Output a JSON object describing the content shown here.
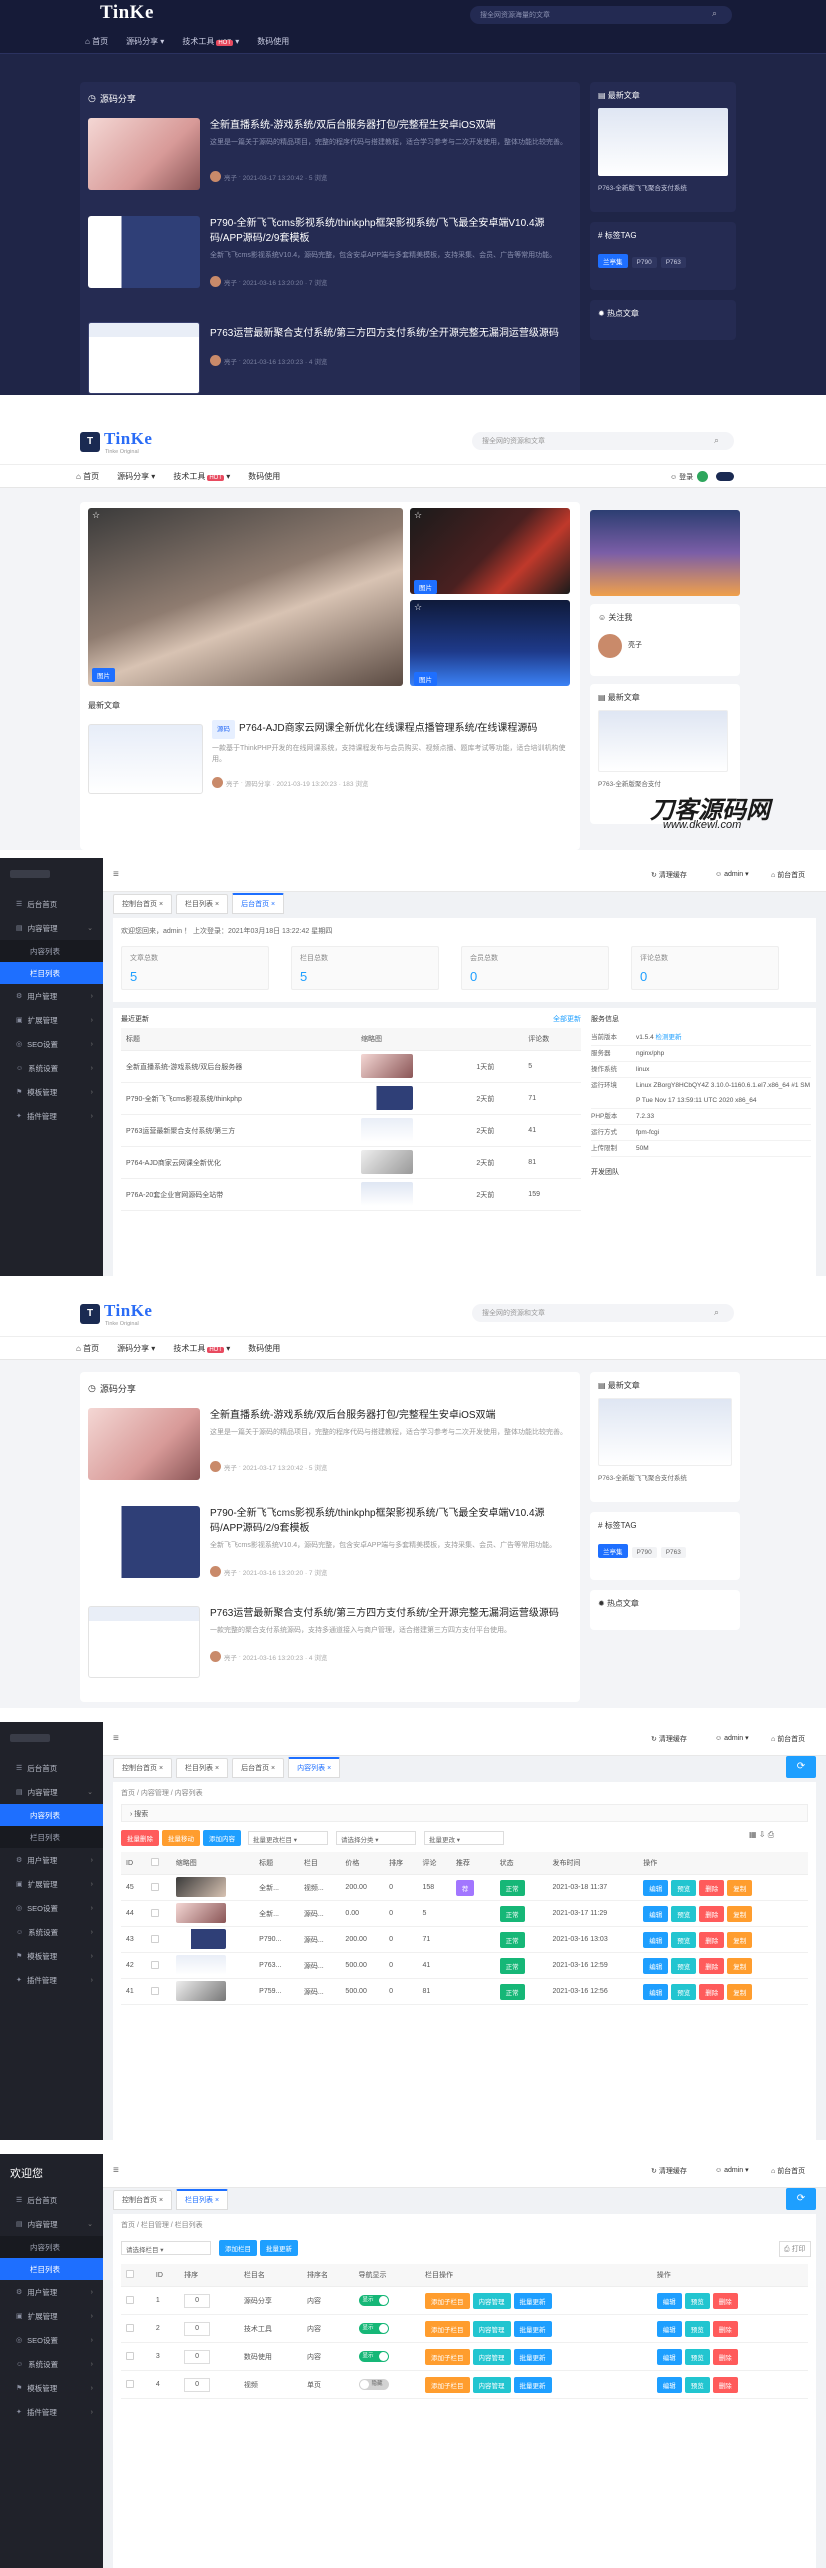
{
  "p1": {
    "logo": "TinKe",
    "search_placeholder": "搜全网资源海量的文章",
    "nav": [
      "首页",
      "源码分享",
      "技术工具",
      "数码使用"
    ],
    "hot": "HOT",
    "section_title": "源码分享",
    "posts": [
      {
        "title": "全新直播系统-游戏系统/双后台服务器打包/完整程生安卓iOS双端",
        "desc": "这里是一篇关于源码的精品项目，完整的程序代码与搭建教程，适合学习参考与二次开发使用，整体功能比较完善。",
        "author": "亮子",
        "meta": "2021-03-17 13:20:42 · 5 浏览"
      },
      {
        "title": "P790-全新飞飞cms影视系统/thinkphp框架影视系统/飞飞最全安卓端V10.4源码/APP源码/2/9套模板",
        "desc": "全新飞飞cms影视系统V10.4，源码完整，包含安卓APP端与多套精美模板，支持采集、会员、广告等常用功能。",
        "author": "亮子",
        "meta": "2021-03-16 13:20:20 · 7 浏览"
      },
      {
        "title": "P763运营最新聚合支付系统/第三方四方支付系统/全开源完整无漏洞运营级源码",
        "desc": "",
        "author": "亮子",
        "meta": "2021-03-16 13:20:23 · 4 浏览"
      }
    ],
    "side1_title": "最新文章",
    "side1_post": "P763-全新版飞飞聚合支付系统",
    "side2_title": "标签TAG",
    "tags": [
      "兰亭集",
      "P790",
      "P763"
    ],
    "side3_title": "热点文章"
  },
  "p2": {
    "logo": "TinKe",
    "logo_sub": "Tinke Original",
    "search_placeholder": "搜全网的资源和文章",
    "nav": [
      "首页",
      "源码分享",
      "技术工具",
      "数码使用"
    ],
    "hot": "HOT",
    "login": "登录",
    "watermark_main": "刀客源码网",
    "watermark_url": "www.dkewl.com",
    "hero_labels": [
      "推荐",
      "推荐",
      "推荐"
    ],
    "hero_tags": [
      "图片",
      "图片",
      "图片"
    ],
    "section_title": "最新文章",
    "post_tag": "源码",
    "post_title": "P764-AJD商家云网课全新优化在线课程点播管理系统/在线课程源码",
    "post_desc": "一款基于ThinkPHP开发的在线网课系统，支持课程发布与会员购买、视频点播、题库考试等功能，适合培训机构使用。",
    "post_author": "亮子",
    "post_meta": "源码分享 · 2021-03-19 13:20:23 · 183 浏览",
    "side_about": "关注我",
    "side_user": "亮子",
    "side_latest": "最新文章",
    "side_latest_post": "P763-全新版聚合支付"
  },
  "p3": {
    "brand": "",
    "menu": [
      {
        "icon": "☰",
        "label": "后台首页",
        "arrow": ""
      },
      {
        "icon": "▤",
        "label": "内容管理",
        "arrow": "⌄",
        "open": true
      },
      {
        "icon": "",
        "label": "内容列表",
        "sub": true,
        "active": false
      },
      {
        "icon": "",
        "label": "栏目列表",
        "sub": true,
        "active": true
      },
      {
        "icon": "⚙",
        "label": "用户管理",
        "arrow": "›"
      },
      {
        "icon": "▣",
        "label": "扩展管理",
        "arrow": "›"
      },
      {
        "icon": "◎",
        "label": "SEO设置",
        "arrow": "›"
      },
      {
        "icon": "☺",
        "label": "系统设置",
        "arrow": "›"
      },
      {
        "icon": "⚑",
        "label": "模板管理",
        "arrow": "›"
      },
      {
        "icon": "✦",
        "label": "插件管理",
        "arrow": "›"
      }
    ],
    "header_clear": "清理缓存",
    "header_user": "admin",
    "header_home": "前台首页",
    "tabs": [
      "控制台首页",
      "栏目列表",
      "后台首页"
    ],
    "welcome": "欢迎您回来，admin ！ 上次登录：2021年03月18日 13:22:42 星期四",
    "stats": [
      {
        "label": "文章总数",
        "value": "5"
      },
      {
        "label": "栏目总数",
        "value": "5"
      },
      {
        "label": "会员总数",
        "value": "0"
      },
      {
        "label": "评论总数",
        "value": "0"
      }
    ],
    "latest_title": "最近更新",
    "latest_more": "全部更新",
    "latest_cols": [
      "标题",
      "缩略图",
      "评论数"
    ],
    "latest_rows": [
      {
        "title": "全新直播系统-游戏系统/双后台服务器",
        "date": "1天前",
        "count": "5"
      },
      {
        "title": "P790-全新飞飞cms影视系统/thinkphp",
        "date": "2天前",
        "count": "71"
      },
      {
        "title": "P763运营最新聚合支付系统/第三方",
        "date": "2天前",
        "count": "41"
      },
      {
        "title": "P764-AJD商家云网课全新优化",
        "date": "2天前",
        "count": "81"
      },
      {
        "title": "P76A-20套企业官网源码全站带",
        "date": "2天前",
        "count": "159"
      }
    ],
    "sys_title": "服务信息",
    "sys": [
      {
        "k": "当前版本",
        "v": "v1.5.4",
        "extra": "检测更新"
      },
      {
        "k": "服务器",
        "v": "nginx/php"
      },
      {
        "k": "操作系统",
        "v": "linux"
      },
      {
        "k": "运行环境",
        "v": "Linux ZBorgY8HCbQY4Z 3.10.0-1160.6.1.el7.x86_64 #1 SMP Tue Nov 17 13:59:11 UTC 2020 x86_64"
      },
      {
        "k": "PHP版本",
        "v": "7.2.33"
      },
      {
        "k": "运行方式",
        "v": "fpm-fcgi"
      },
      {
        "k": "上传限制",
        "v": "50M"
      }
    ],
    "team": "开发团队"
  },
  "p4": {
    "logo": "TinKe",
    "logo_sub": "Tinke Original",
    "search_placeholder": "搜全网的资源和文章",
    "nav": [
      "首页",
      "源码分享",
      "技术工具",
      "数码使用"
    ],
    "hot": "HOT",
    "section_title": "源码分享",
    "posts": [
      {
        "title": "全新直播系统-游戏系统/双后台服务器打包/完整程生安卓iOS双端",
        "desc": "这里是一篇关于源码的精品项目，完整的程序代码与搭建教程，适合学习参考与二次开发使用，整体功能比较完善。",
        "author": "亮子",
        "meta": "2021-03-17 13:20:42 · 5 浏览"
      },
      {
        "title": "P790-全新飞飞cms影视系统/thinkphp框架影视系统/飞飞最全安卓端V10.4源码/APP源码/2/9套模板",
        "desc": "全新飞飞cms影视系统V10.4，源码完整，包含安卓APP端与多套精美模板，支持采集、会员、广告等常用功能。",
        "author": "亮子",
        "meta": "2021-03-16 13:20:20 · 7 浏览"
      },
      {
        "title": "P763运营最新聚合支付系统/第三方四方支付系统/全开源完整无漏洞运营级源码",
        "desc": "一款完整的聚合支付系统源码，支持多通道接入与商户管理，适合搭建第三方四方支付平台使用。",
        "author": "亮子",
        "meta": "2021-03-16 13:20:23 · 4 浏览"
      }
    ],
    "side1_title": "最新文章",
    "side1_post": "P763-全新版飞飞聚合支付系统",
    "side2_title": "标签TAG",
    "tags": [
      "兰亭集",
      "P790",
      "P763"
    ],
    "side3_title": "热点文章"
  },
  "p5": {
    "menu": [
      {
        "icon": "☰",
        "label": "后台首页",
        "arrow": ""
      },
      {
        "icon": "▤",
        "label": "内容管理",
        "arrow": "⌄"
      },
      {
        "icon": "",
        "label": "内容列表",
        "sub": true,
        "active": true
      },
      {
        "icon": "",
        "label": "栏目列表",
        "sub": true,
        "active": false
      },
      {
        "icon": "⚙",
        "label": "用户管理",
        "arrow": "›"
      },
      {
        "icon": "▣",
        "label": "扩展管理",
        "arrow": "›"
      },
      {
        "icon": "◎",
        "label": "SEO设置",
        "arrow": "›"
      },
      {
        "icon": "☺",
        "label": "系统设置",
        "arrow": "›"
      },
      {
        "icon": "⚑",
        "label": "模板管理",
        "arrow": "›"
      },
      {
        "icon": "✦",
        "label": "插件管理",
        "arrow": "›"
      }
    ],
    "header_clear": "清理缓存",
    "header_user": "admin",
    "header_home": "前台首页",
    "tabs": [
      "控制台首页",
      "栏目列表",
      "后台首页",
      "内容列表"
    ],
    "breadcrumb": "首页 / 内容管理 / 内容列表",
    "search_label": "搜索",
    "buttons": [
      "批量删除",
      "批量移动",
      "添加内容"
    ],
    "filters": [
      "批量更改栏目",
      "请选择分类",
      "批量更改"
    ],
    "cols": [
      "ID",
      "",
      "缩略图",
      "标题",
      "栏目",
      "价格",
      "排序",
      "评论",
      "推荐",
      "状态",
      "发布时间",
      "操作"
    ],
    "rows": [
      {
        "id": "45",
        "title": "全新...",
        "cat": "视频...",
        "price": "200.00",
        "sort": "0",
        "views": "158",
        "rec": "荐",
        "status": "正常",
        "time": "2021-03-18 11:37"
      },
      {
        "id": "44",
        "title": "全新...",
        "cat": "源码...",
        "price": "0.00",
        "sort": "0",
        "views": "5",
        "rec": "",
        "status": "正常",
        "time": "2021-03-17 11:29"
      },
      {
        "id": "43",
        "title": "P790...",
        "cat": "源码...",
        "price": "200.00",
        "sort": "0",
        "views": "71",
        "rec": "",
        "status": "正常",
        "time": "2021-03-16 13:03"
      },
      {
        "id": "42",
        "title": "P763...",
        "cat": "源码...",
        "price": "500.00",
        "sort": "0",
        "views": "41",
        "rec": "",
        "status": "正常",
        "time": "2021-03-16 12:59"
      },
      {
        "id": "41",
        "title": "P759...",
        "cat": "源码...",
        "price": "500.00",
        "sort": "0",
        "views": "81",
        "rec": "",
        "status": "正常",
        "time": "2021-03-16 12:56"
      }
    ],
    "ops": [
      "编辑",
      "预览",
      "删除",
      "复制"
    ]
  },
  "p6": {
    "brand": "欢迎您",
    "menu": [
      {
        "icon": "☰",
        "label": "后台首页",
        "arrow": ""
      },
      {
        "icon": "▤",
        "label": "内容管理",
        "arrow": "⌄"
      },
      {
        "icon": "",
        "label": "内容列表",
        "sub": true,
        "active": false
      },
      {
        "icon": "",
        "label": "栏目列表",
        "sub": true,
        "active": true
      },
      {
        "icon": "⚙",
        "label": "用户管理",
        "arrow": "›"
      },
      {
        "icon": "▣",
        "label": "扩展管理",
        "arrow": "›"
      },
      {
        "icon": "◎",
        "label": "SEO设置",
        "arrow": "›"
      },
      {
        "icon": "☺",
        "label": "系统设置",
        "arrow": "›"
      },
      {
        "icon": "⚑",
        "label": "模板管理",
        "arrow": "›"
      },
      {
        "icon": "✦",
        "label": "插件管理",
        "arrow": "›"
      }
    ],
    "header_clear": "清理缓存",
    "header_user": "admin",
    "header_home": "前台首页",
    "tabs": [
      "控制台首页",
      "栏目列表"
    ],
    "breadcrumb": "首页 / 栏目管理 / 栏目列表",
    "select_placeholder": "请选择栏目",
    "buttons": [
      "添加栏目",
      "批量更新"
    ],
    "print": "打印",
    "cols": [
      "",
      "ID",
      "排序",
      "栏目名",
      "排序名",
      "导航显示",
      "栏目操作",
      "操作"
    ],
    "rows": [
      {
        "id": "1",
        "sort": "0",
        "name": "源码分享",
        "type": "内容",
        "nav": "显示",
        "on": true
      },
      {
        "id": "2",
        "sort": "0",
        "name": "技术工具",
        "type": "内容",
        "nav": "显示",
        "on": true
      },
      {
        "id": "3",
        "sort": "0",
        "name": "数码使用",
        "type": "内容",
        "nav": "显示",
        "on": true
      },
      {
        "id": "4",
        "sort": "0",
        "name": "视频",
        "type": "单页",
        "nav": "隐藏",
        "on": false
      }
    ],
    "col_ops": [
      "添加子栏目",
      "内容管理",
      "批量更新"
    ],
    "row_ops": [
      "编辑",
      "预览",
      "删除"
    ]
  }
}
